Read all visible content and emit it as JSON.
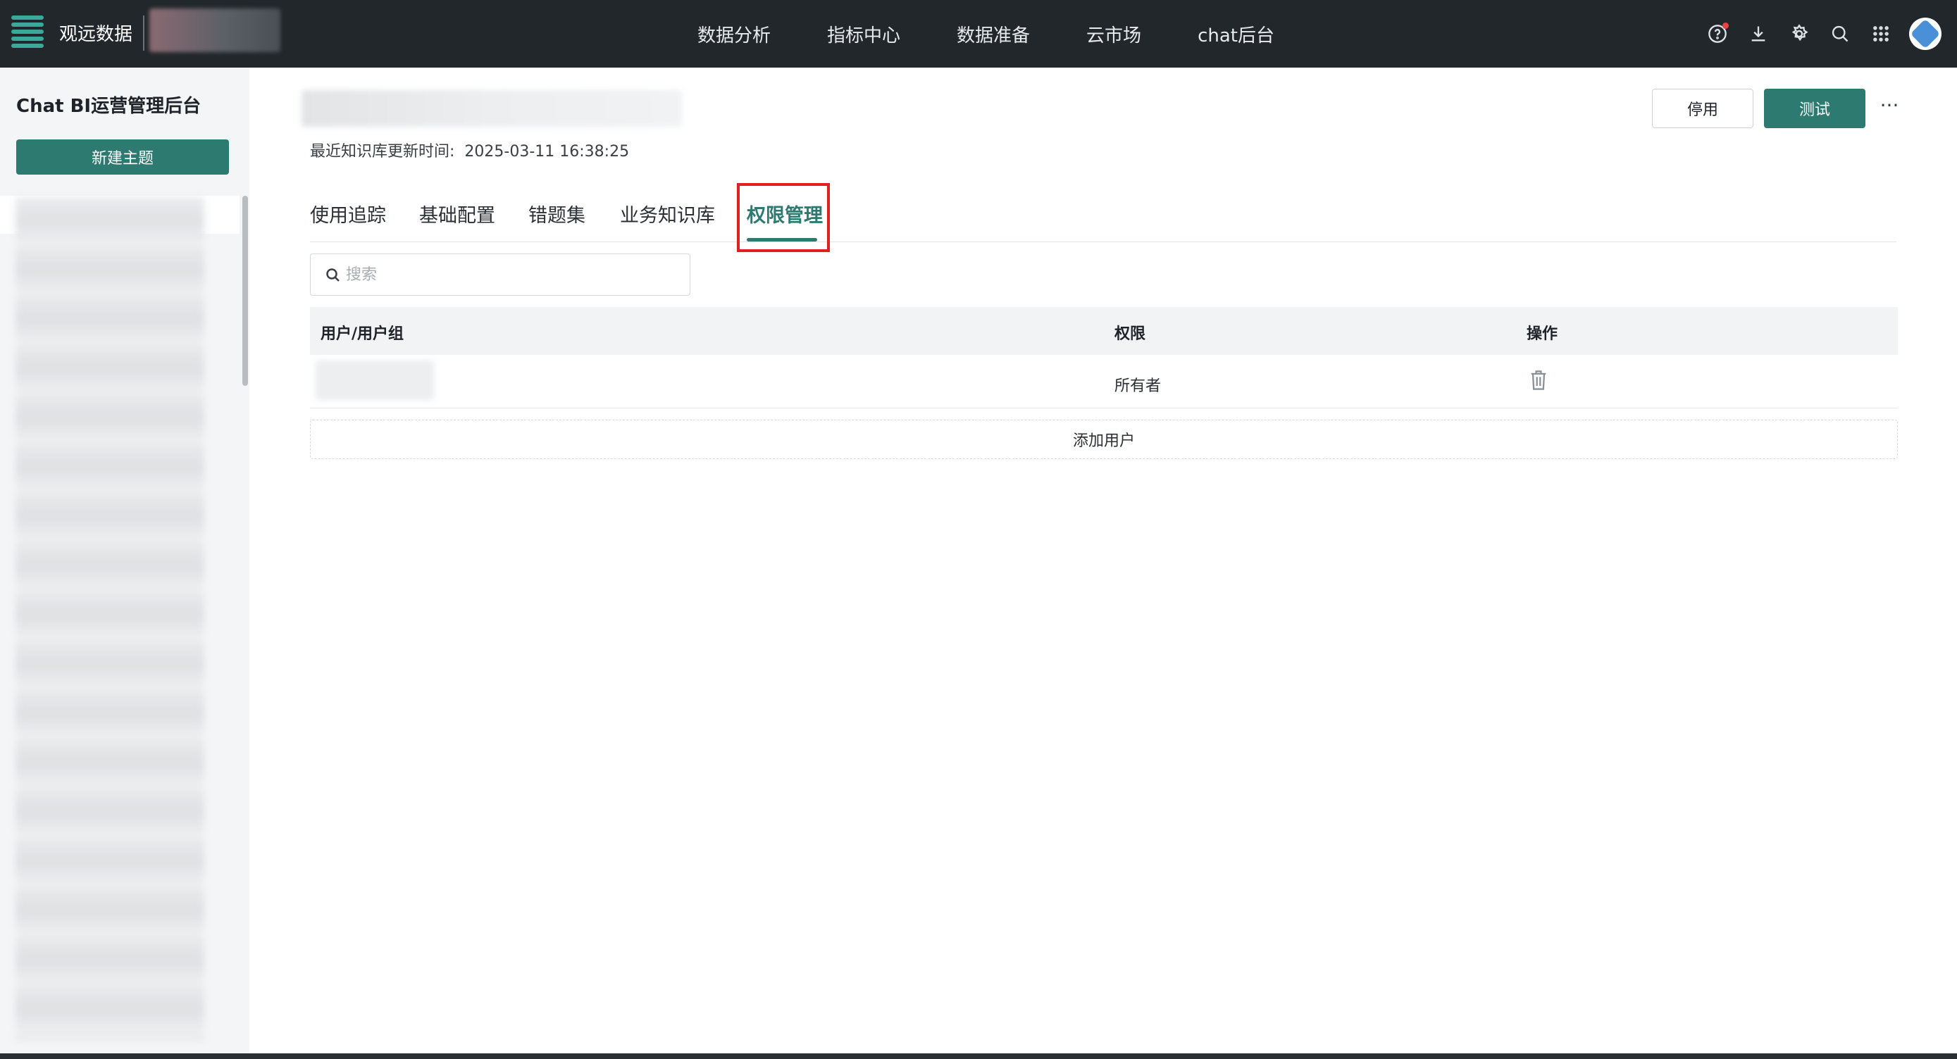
{
  "topbar": {
    "brand": "观远数据",
    "nav": [
      "数据分析",
      "指标中心",
      "数据准备",
      "云市场",
      "chat后台"
    ],
    "icons": [
      "help-icon",
      "download-icon",
      "settings-icon",
      "search-icon",
      "apps-grid-icon"
    ]
  },
  "sidebar": {
    "title": "Chat BI运营管理后台",
    "new_topic_label": "新建主题"
  },
  "main": {
    "update_label": "最近知识库更新时间:",
    "update_time": "2025-03-11 16:38:25",
    "disable_label": "停用",
    "test_label": "测试",
    "more_label": "···",
    "tabs": [
      {
        "label": "使用追踪",
        "active": false
      },
      {
        "label": "基础配置",
        "active": false
      },
      {
        "label": "错题集",
        "active": false
      },
      {
        "label": "业务知识库",
        "active": false
      },
      {
        "label": "权限管理",
        "active": true
      }
    ],
    "search_placeholder": "搜索",
    "table": {
      "headers": [
        "用户/用户组",
        "权限",
        "操作"
      ],
      "rows": [
        {
          "permission": "所有者"
        }
      ]
    },
    "add_user_label": "添加用户"
  },
  "colors": {
    "accent": "#2c7a70",
    "topbar_bg": "#21272b",
    "highlight": "#e02020"
  }
}
